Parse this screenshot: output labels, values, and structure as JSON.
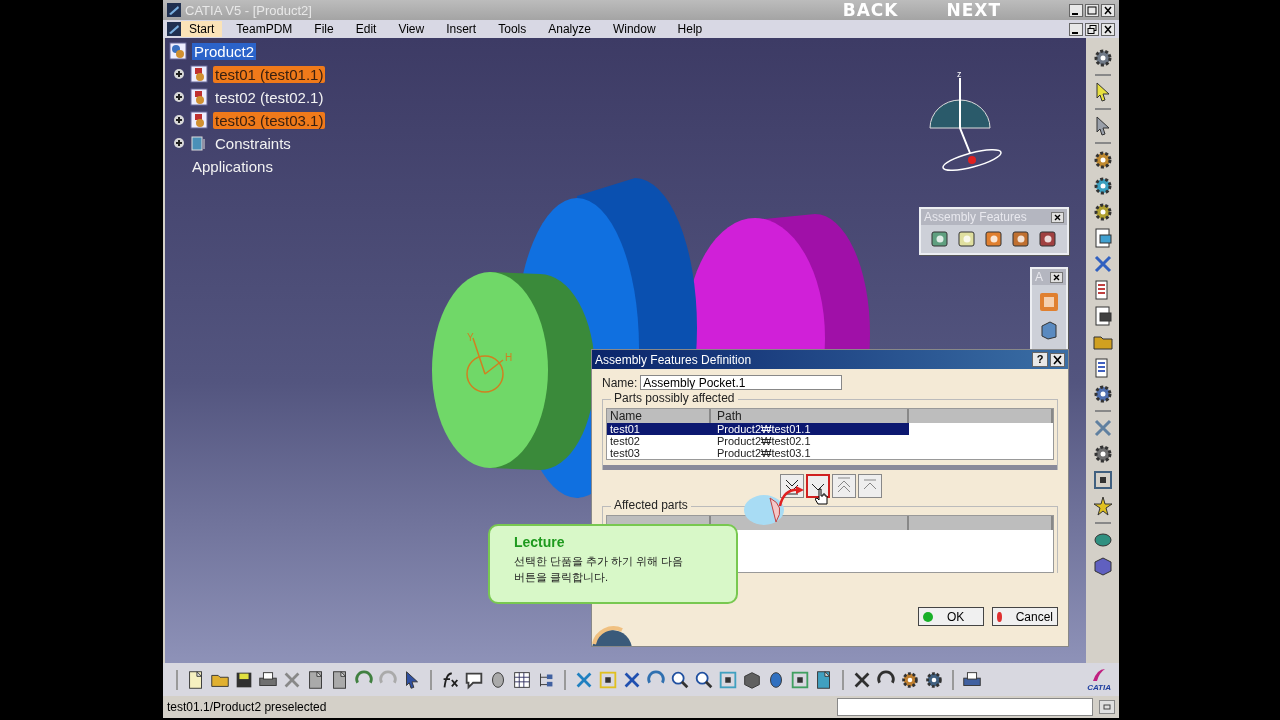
{
  "window": {
    "title": "CATIA V5 - [Product2]"
  },
  "nav": {
    "back": "BACK",
    "next": "NEXT"
  },
  "menu": [
    {
      "label": "Start",
      "selected": true
    },
    {
      "label": "TeamPDM",
      "selected": false
    },
    {
      "label": "File",
      "selected": false
    },
    {
      "label": "Edit",
      "selected": false
    },
    {
      "label": "View",
      "selected": false
    },
    {
      "label": "Insert",
      "selected": false
    },
    {
      "label": "Tools",
      "selected": false
    },
    {
      "label": "Analyze",
      "selected": false
    },
    {
      "label": "Window",
      "selected": false
    },
    {
      "label": "Help",
      "selected": false
    }
  ],
  "tree": {
    "root": {
      "label": "Product2",
      "selected": true
    },
    "children": [
      {
        "label": "test01 (test01.1)",
        "kind": "part",
        "highlighted": true
      },
      {
        "label": "test02 (test02.1)",
        "kind": "part",
        "highlighted": false
      },
      {
        "label": "test03 (test03.1)",
        "kind": "part",
        "highlighted": true
      },
      {
        "label": "Constraints",
        "kind": "constraints",
        "highlighted": false
      },
      {
        "label": "Applications",
        "kind": "plain",
        "highlighted": false
      }
    ]
  },
  "compass": {
    "axis": "z"
  },
  "part_axes": [
    "Y",
    "H"
  ],
  "toolbars": [
    {
      "title": "Assembly Features"
    },
    {
      "title": "A"
    }
  ],
  "dialog": {
    "title": "Assembly Features Definition",
    "help": "?",
    "name_label": "Name:",
    "name_value": "Assembly Pocket.1",
    "possible": {
      "title": "Parts possibly affected",
      "columns": [
        "Name",
        "Path"
      ],
      "rows": [
        {
          "name": "test01",
          "path": "Product2₩test01.1",
          "selected": true
        },
        {
          "name": "test02",
          "path": "Product2₩test02.1",
          "selected": false
        },
        {
          "name": "test03",
          "path": "Product2₩test03.1",
          "selected": false
        }
      ]
    },
    "affected": {
      "title": "Affected parts"
    },
    "buttons": [
      {
        "label": "OK",
        "kind": "ok"
      },
      {
        "label": "Cancel",
        "kind": "cancel"
      }
    ]
  },
  "lecture": {
    "title": "Lecture",
    "lines": [
      "선택한 단품을 추가 하기 위해 다음",
      "버튼을 클릭합니다."
    ]
  },
  "status": {
    "text": "test01.1/Product2 preselected"
  },
  "logo": "CATIA"
}
